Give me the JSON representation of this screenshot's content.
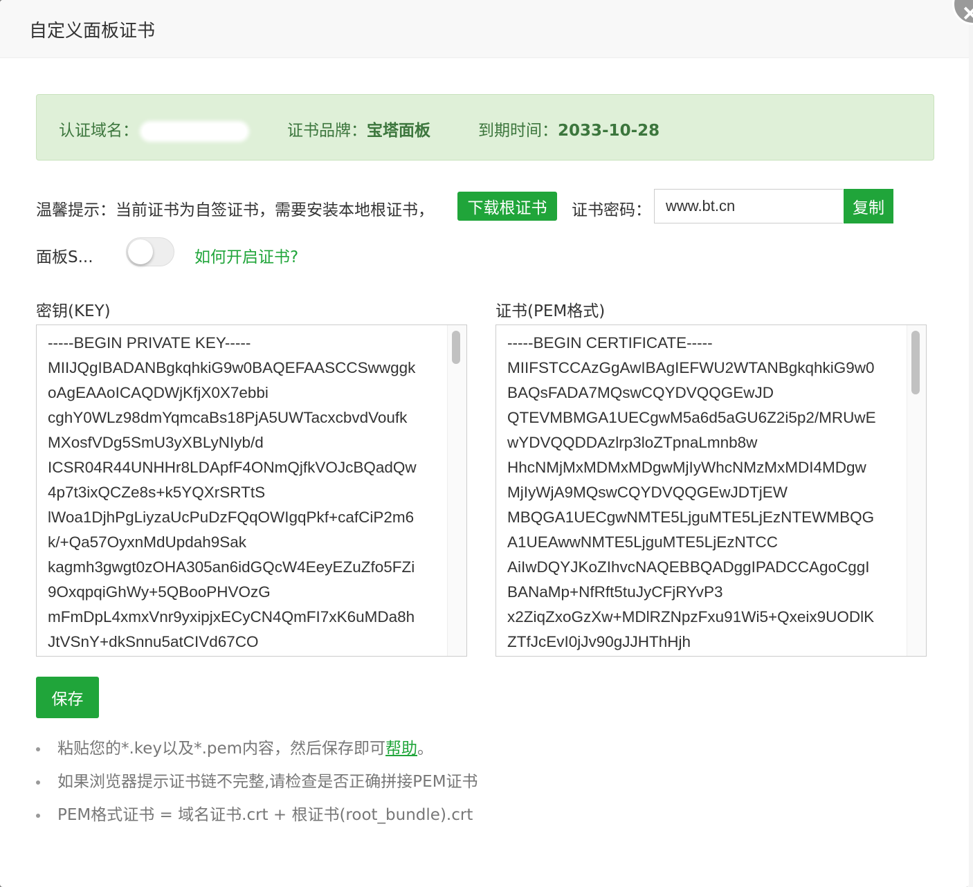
{
  "dialog": {
    "title": "自定义面板证书"
  },
  "info": {
    "domain_label": "认证域名：",
    "brand_label": "证书品牌：",
    "brand_value": "宝塔面板",
    "expiry_label": "到期时间：",
    "expiry_value": "2033-10-28"
  },
  "tip": {
    "text": "温馨提示：当前证书为自签证书，需要安装本地根证书，",
    "download_label": "下载根证书",
    "password_label": "证书密码：",
    "password_value": "www.bt.cn",
    "copy_label": "复制"
  },
  "ssl": {
    "label": "面板S...",
    "enabled": false,
    "howto_link": "如何开启证书?"
  },
  "key": {
    "label": "密钥(KEY)",
    "lines": [
      "-----BEGIN PRIVATE KEY-----",
      "MIIJQgIBADANBgkqhkiG9w0BAQEFAASCCSwwggk",
      "oAgEAAoICAQDWjKfjX0X7ebbi",
      "cghY0WLz98dmYqmcaBs18PjA5UWTacxcbvdVoufk",
      "MXosfVDg5SmU3yXBLyNIyb/d",
      "ICSR04R44UNHHr8LDApfF4ONmQjfkVOJcBQadQw",
      "4p7t3ixQCZe8s+k5YQXrSRTtS",
      "lWoa1DjhPgLiyzaUcPuDzFQqOWIgqPkf+cafCiP2m6",
      "k/+Qa57OyxnMdUpdah9Sak",
      "kagmh3gwgt0zOHA305an6idGQcW4EeyEZuZfo5FZi",
      "9OxqpqiGhWy+5QBooPHVOzG",
      "mFmDpL4xmxVnr9yxipjxECyCN4QmFI7xK6uMDa8h",
      "JtVSnY+dkSnnu5atCIVd67CO"
    ]
  },
  "cert": {
    "label": "证书(PEM格式)",
    "lines": [
      "-----BEGIN CERTIFICATE-----",
      "MIIFSTCCAzGgAwIBAgIEFWU2WTANBgkqhkiG9w0",
      "BAQsFADA7MQswCQYDVQQGEwJD",
      "QTEVMBMGA1UECgwM5a6d5aGU6Z2i5p2/MRUwE",
      "wYDVQQDDAzlrp3loZTpnaLmnb8w",
      "HhcNMjMxMDMxMDgwMjIyWhcNMzMxMDI4MDgw",
      "MjIyWjA9MQswCQYDVQQGEwJDTjEW",
      "MBQGA1UECgwNMTE5LjguMTE5LjEzNTEWMBQG",
      "A1UEAwwNMTE5LjguMTE5LjEzNTCC",
      "AiIwDQYJKoZIhvcNAQEBBQADggIPADCCAgoCggI",
      "BANaMp+NfRft5tuJyCFjRYvP3",
      "x2ZiqZxoGzXw+MDlRZNpzFxu91Wi5+Qxeix9UODlK",
      "ZTfJcEvI0jJv90gJJHThHjh"
    ]
  },
  "save_label": "保存",
  "notes": {
    "n1_text": "粘贴您的*.key以及*.pem内容，然后保存即可",
    "n1_link": "帮助",
    "n1_end": "。",
    "n2_text": "如果浏览器提示证书链不完整,请检查是否正确拼接PEM证书",
    "n3_text": "PEM格式证书 = 域名证书.crt + 根证书(root_bundle).crt"
  },
  "colors": {
    "accent": "#20a53a",
    "info_bg": "#dff0d8",
    "info_text": "#3c763d"
  }
}
